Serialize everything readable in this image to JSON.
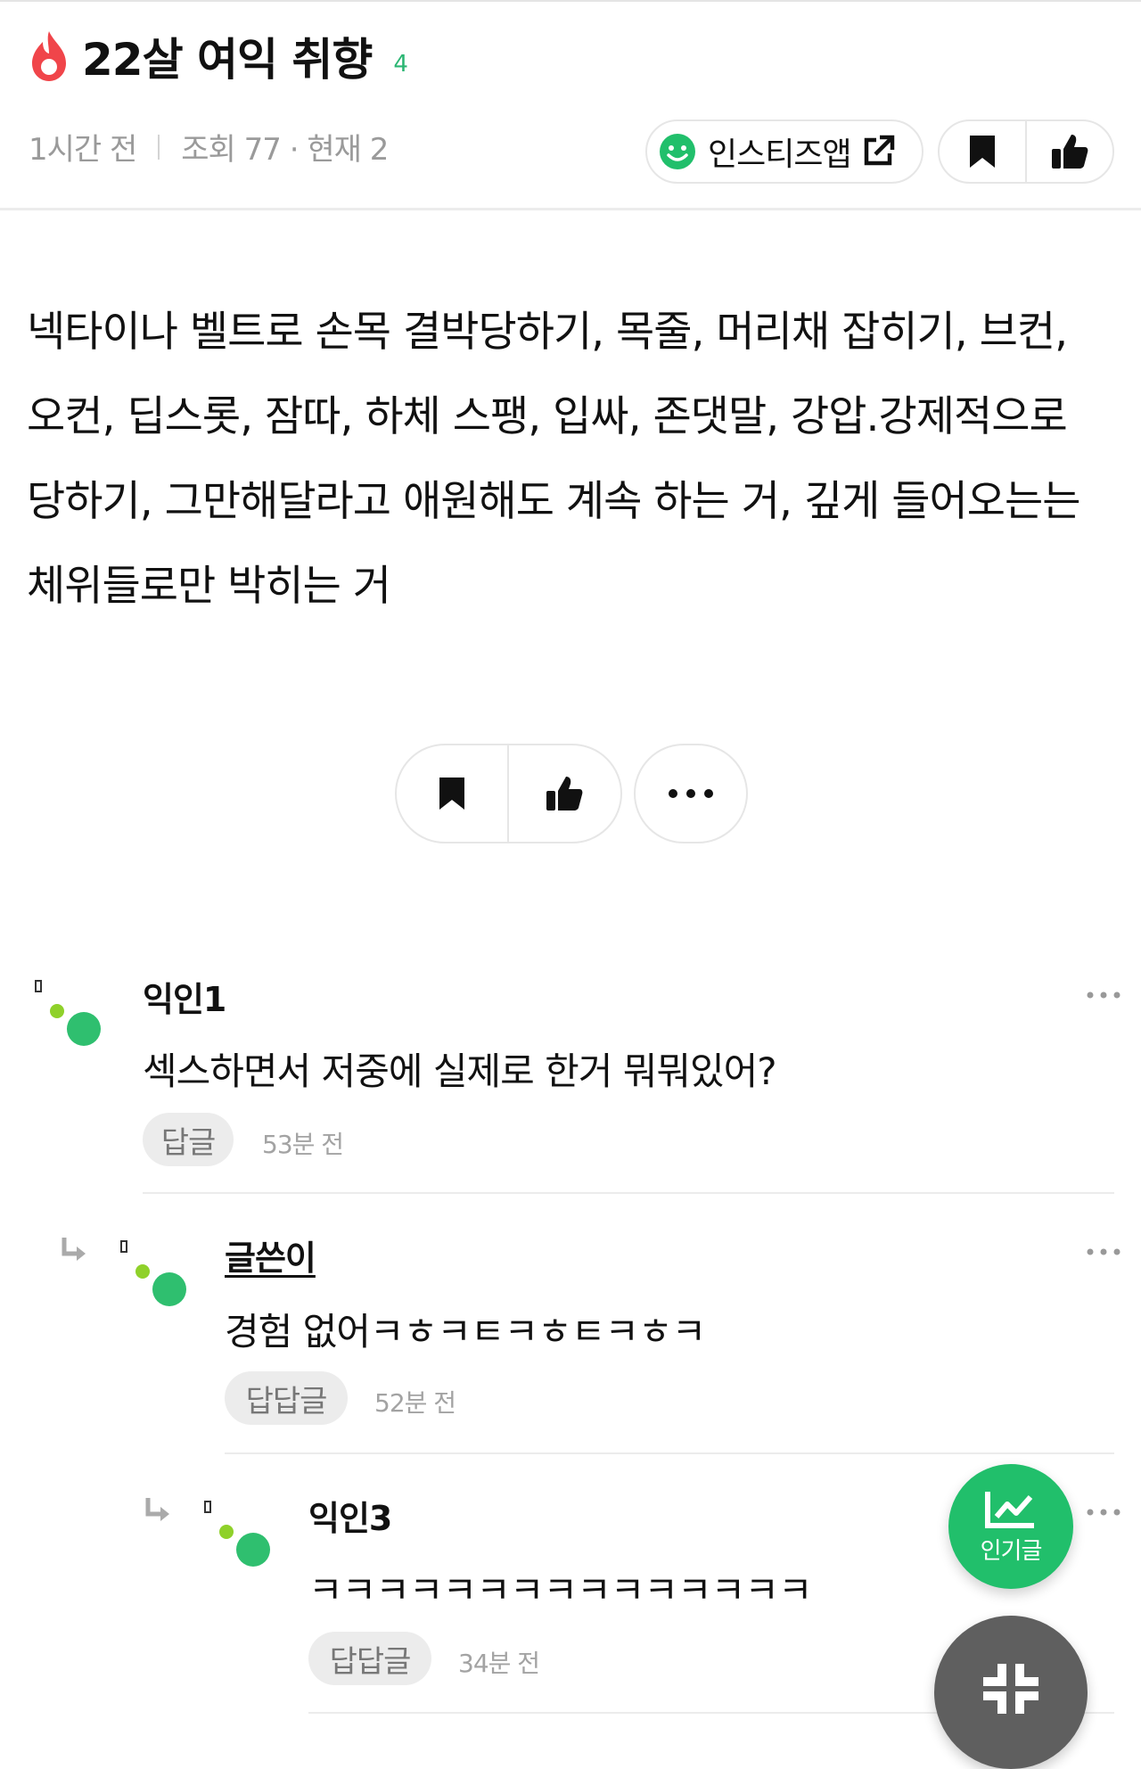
{
  "post": {
    "title": "22살 여익 취향",
    "comment_count": "4",
    "time": "1시간 전",
    "views": "조회 77 · 현재 2",
    "app_button_label": "인스티즈앱",
    "body": "넥타이나 벨트로 손목 결박당하기, 목줄, 머리채 잡히기, 브컨, 오컨, 딥스롯, 잠따, 하체 스팽, 입싸, 존댓말, 강압.강제적으로 당하기, 그만해달라고 애원해도 계속 하는 거, 깊게 들어오는는 체위들로만 박히는 거"
  },
  "comments": [
    {
      "name": "익인1",
      "text": "섹스하면서 저중에 실제로 한거 뭐뭐있어?",
      "reply_label": "답글",
      "time": "53분 전"
    },
    {
      "name": "글쓴이",
      "text": "경험 없어ㅋㅎㅋㅌㅋㅎㅌㅋㅎㅋ",
      "reply_label": "답답글",
      "time": "52분 전"
    },
    {
      "name": "익인3",
      "text": "ㅋㅋㅋㅋㅋㅋㅋㅋㅋㅋㅋㅋㅋㅋㅋ",
      "reply_label": "답답글",
      "time": "34분 전"
    }
  ],
  "floating": {
    "hot_label": "인기글"
  },
  "icons": {
    "title": "fire-icon",
    "app": "smile-icon",
    "external": "external-link-icon",
    "bookmark": "bookmark-icon",
    "like": "thumbs-up-icon",
    "more": "more-dots-icon",
    "reply": "reply-arrow-icon",
    "hot": "trend-chart-icon",
    "collapse": "collapse-icon"
  },
  "colors": {
    "accent_green": "#21bf6b",
    "fire_red": "#f0454a",
    "muted_text": "#9a9a9a"
  }
}
